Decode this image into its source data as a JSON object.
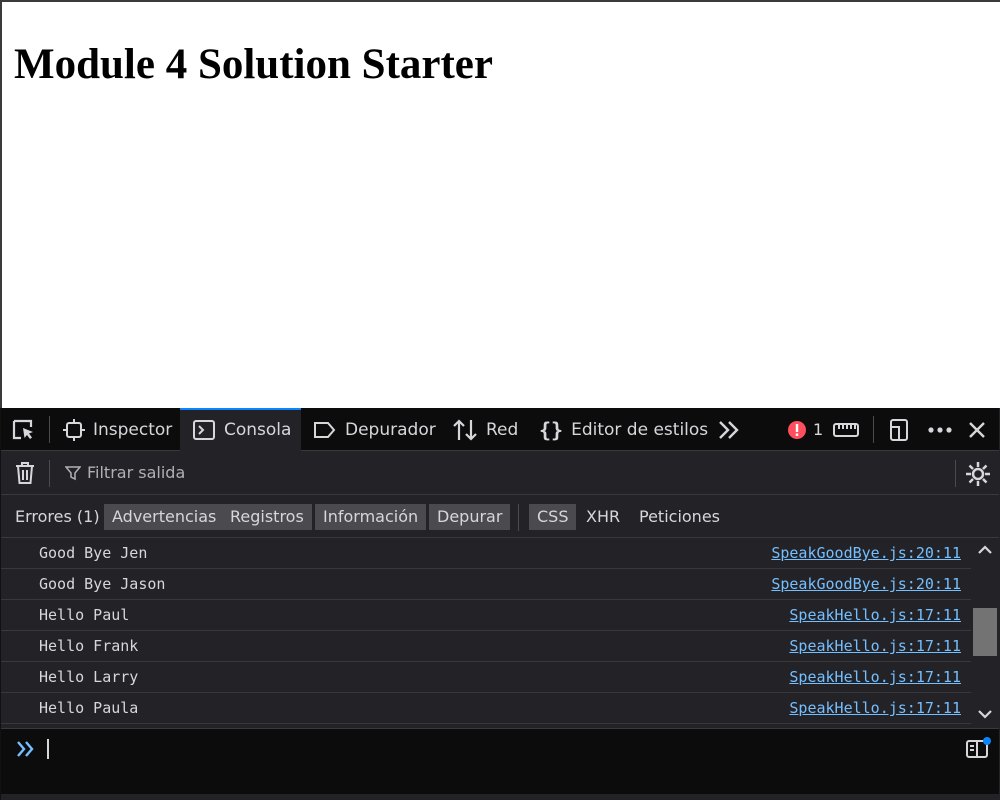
{
  "page": {
    "heading": "Module 4 Solution Starter"
  },
  "devtools": {
    "tabs": [
      {
        "label": "Inspector",
        "icon": "inspector-icon"
      },
      {
        "label": "Consola",
        "icon": "console-icon",
        "selected": true
      },
      {
        "label": "Depurador",
        "icon": "debugger-icon"
      },
      {
        "label": "Red",
        "icon": "network-icon"
      },
      {
        "label": "Editor de estilos",
        "icon": "style-editor-icon"
      }
    ],
    "error_count": "1",
    "filter_placeholder": "Filtrar salida",
    "levels": [
      {
        "label": "Errores (1)",
        "on": false
      },
      {
        "label": "Advertencias",
        "on": true
      },
      {
        "label": "Registros",
        "on": true
      },
      {
        "label": "Información",
        "on": true
      },
      {
        "label": "Depurar",
        "on": true
      },
      {
        "label": "CSS",
        "on": true
      },
      {
        "label": "XHR",
        "on": false
      },
      {
        "label": "Peticiones",
        "on": false
      }
    ],
    "logs": [
      {
        "message": "Good Bye Jen",
        "source": "SpeakGoodBye.js:20:11"
      },
      {
        "message": "Good Bye Jason",
        "source": "SpeakGoodBye.js:20:11"
      },
      {
        "message": "Hello Paul",
        "source": "SpeakHello.js:17:11"
      },
      {
        "message": "Hello Frank",
        "source": "SpeakHello.js:17:11"
      },
      {
        "message": "Hello Larry",
        "source": "SpeakHello.js:17:11"
      },
      {
        "message": "Hello Paula",
        "source": "SpeakHello.js:17:11"
      }
    ],
    "accent_color": "#0a84ff",
    "link_color": "#75bfff",
    "error_color": "#ff4f5e"
  }
}
